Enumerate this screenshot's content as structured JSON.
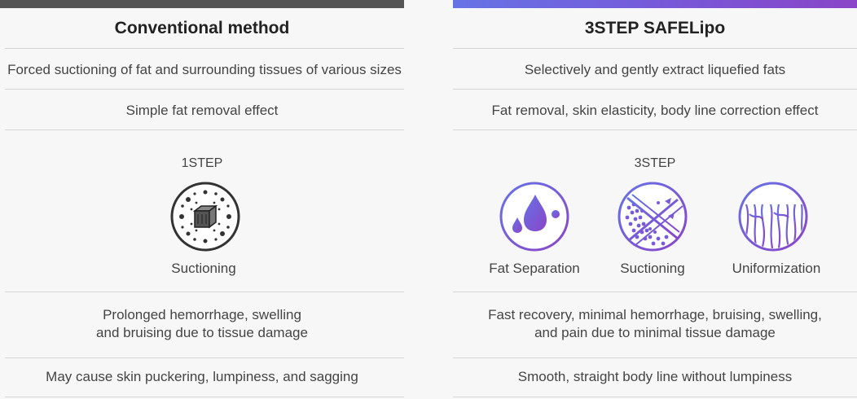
{
  "conventional": {
    "title": "Conventional method",
    "row1": "Forced suctioning of fat and surrounding tissues of various sizes",
    "row2": "Simple fat removal effect",
    "step_label": "1STEP",
    "step_item": "Suctioning",
    "row4_line1": "Prolonged hemorrhage, swelling",
    "row4_line2": "and bruising due to tissue damage",
    "row5": "May cause skin puckering, lumpiness, and sagging"
  },
  "safelipo": {
    "title": "3STEP SAFELipo",
    "row1": "Selectively and gently extract liquefied fats",
    "row2": "Fat removal, skin elasticity, body line correction effect",
    "step_label": "3STEP",
    "steps": [
      {
        "label": "Fat Separation",
        "icon": "droplet-icon"
      },
      {
        "label": "Suctioning",
        "icon": "suction-icon"
      },
      {
        "label": "Uniformization",
        "icon": "uniform-icon"
      }
    ],
    "row4_line1": "Fast recovery, minimal hemorrhage, bruising, swelling,",
    "row4_line2": "and pain due to minimal tissue damage",
    "row5": "Smooth, straight body line without lumpiness"
  },
  "colors": {
    "accent_purple": "#7a55d6",
    "accent_blue": "#6673e6",
    "dark_bar": "#555555"
  }
}
